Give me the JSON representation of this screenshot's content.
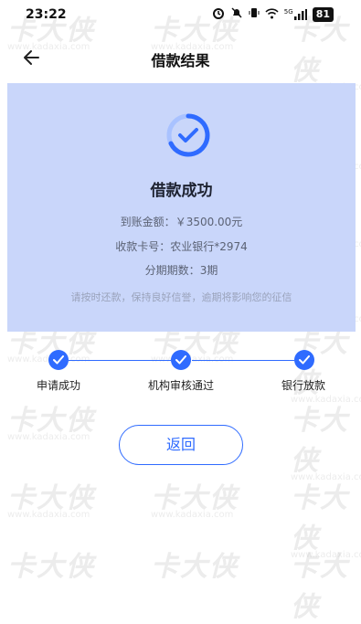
{
  "status_bar": {
    "time": "23:22",
    "signal_text": "5G",
    "battery": "81"
  },
  "nav": {
    "title": "借款结果"
  },
  "result": {
    "title": "借款成功",
    "amount_label": "到账金额：",
    "amount_value": "￥3500.00元",
    "card_label": "收款卡号：",
    "card_value": "农业银行*2974",
    "term_label": "分期期数：",
    "term_value": "3期",
    "notice": "请按时还款，保持良好信誉，逾期将影响您的征信"
  },
  "steps": [
    {
      "label": "申请成功"
    },
    {
      "label": "机构审核通过"
    },
    {
      "label": "银行放款"
    }
  ],
  "return_button": "返回",
  "watermark": {
    "brand": "卡大侠",
    "url": "www.kadaxia.com"
  },
  "colors": {
    "accent": "#2f6bff",
    "panel_bg": "#c9d6fa"
  }
}
